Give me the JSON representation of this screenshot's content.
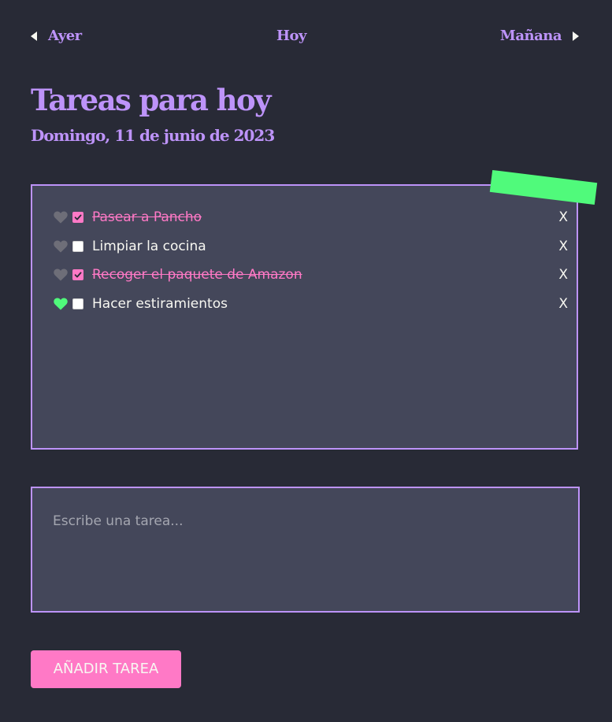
{
  "nav": {
    "prev_label": "Ayer",
    "today_label": "Hoy",
    "next_label": "Mañana"
  },
  "header": {
    "title": "Tareas para hoy",
    "date": "Domingo, 11 de junio de 2023"
  },
  "tasks": [
    {
      "text": "Pasear a Pancho",
      "done": true,
      "favorite": false,
      "delete_label": "X"
    },
    {
      "text": "Limpiar la cocina",
      "done": false,
      "favorite": false,
      "delete_label": "X"
    },
    {
      "text": "Recoger el paquete de Amazon",
      "done": true,
      "favorite": false,
      "delete_label": "X"
    },
    {
      "text": "Hacer estiramientos",
      "done": false,
      "favorite": true,
      "delete_label": "X"
    }
  ],
  "new_task": {
    "value": "",
    "placeholder": "Escribe una tarea..."
  },
  "add_button_label": "AÑADIR TAREA",
  "icons": {
    "prev": "triangle-left-icon",
    "next": "triangle-right-icon",
    "favorite": "heart-icon",
    "checkbox": "checkbox-icon"
  },
  "colors": {
    "background": "#282a36",
    "panel": "#44475a",
    "accent": "#bd93f9",
    "pink": "#ff79c6",
    "green": "#50fa7b",
    "heart_inactive": "#6e6e78",
    "text": "#f8f8f2"
  }
}
